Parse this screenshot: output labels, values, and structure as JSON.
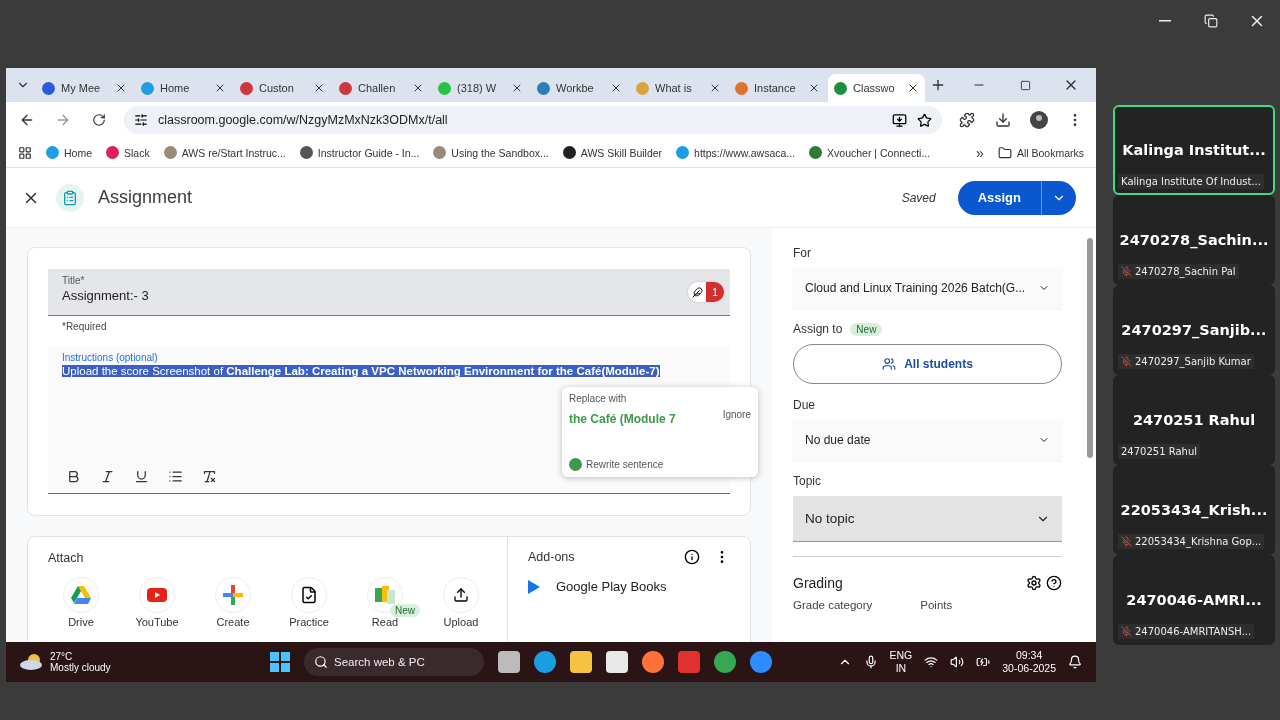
{
  "browser": {
    "tabs": [
      {
        "label": "My Mee",
        "selected": false,
        "color": "#2d5bd8"
      },
      {
        "label": "Home",
        "selected": false,
        "color": "#1f9ce4"
      },
      {
        "label": "Custon",
        "selected": false,
        "color": "#d0343e"
      },
      {
        "label": "Challen",
        "selected": false,
        "color": "#d0343e"
      },
      {
        "label": "(318) W",
        "selected": false,
        "color": "#25c449"
      },
      {
        "label": "Workbe",
        "selected": false,
        "color": "#2a7fb8"
      },
      {
        "label": "What is",
        "selected": false,
        "color": "#d9a53a"
      },
      {
        "label": "Instance",
        "selected": false,
        "color": "#e0722b"
      },
      {
        "label": "Classwo",
        "selected": true,
        "color": "#1e8e3e"
      }
    ],
    "url": "classroom.google.com/w/NzgyMzMxNzk3ODMx/t/all",
    "bookmarks": [
      {
        "label": "Home",
        "color": "#1f9ce4"
      },
      {
        "label": "Slack",
        "color": "#e01e5a"
      },
      {
        "label": "AWS re/Start Instruc...",
        "color": "#9a8a7a"
      },
      {
        "label": "Instructor Guide - In...",
        "color": "#555555"
      },
      {
        "label": "Using the Sandbox...",
        "color": "#9a8a7a"
      },
      {
        "label": "AWS Skill Builder",
        "color": "#222222"
      },
      {
        "label": "https://www.awsaca...",
        "color": "#1f9ce4"
      },
      {
        "label": "Xvoucher | Connecti...",
        "color": "#2e7d32"
      }
    ],
    "bookmarks_more": "»",
    "all_bookmarks": "All Bookmarks"
  },
  "classroom": {
    "header": {
      "title": "Assignment",
      "status": "Saved",
      "assign": "Assign"
    },
    "title_field": {
      "label": "Title*",
      "value": "Assignment:- 3",
      "issues": "1"
    },
    "required_note": "*Required",
    "instructions": {
      "label": "Instructions (optional)",
      "value": "Upload the score Screenshot of  **Challenge Lab: Creating a VPC Networking Environment for the Café(Module-7)**",
      "selected": true
    },
    "suggestion": {
      "heading": "Replace with",
      "replacement": "the Café (Module 7",
      "ignore": "Ignore",
      "rewrite": "Rewrite sentence"
    },
    "attach": {
      "heading": "Attach",
      "items": [
        {
          "kind": "drive",
          "label": "Drive"
        },
        {
          "kind": "youtube",
          "label": "YouTube"
        },
        {
          "kind": "create",
          "label": "Create"
        },
        {
          "kind": "practice",
          "label": "Practice"
        },
        {
          "kind": "read",
          "label": "Read",
          "badge": "New"
        },
        {
          "kind": "upload",
          "label": "Upload"
        }
      ]
    },
    "addons": {
      "heading": "Add-ons",
      "items": [
        "Google Play Books"
      ]
    },
    "sidebar": {
      "for": {
        "label": "For",
        "value": "Cloud and Linux Training 2026 Batch(G..."
      },
      "assign_to": {
        "label": "Assign to",
        "badge": "New",
        "button": "All students"
      },
      "due": {
        "label": "Due",
        "value": "No due date"
      },
      "topic": {
        "label": "Topic",
        "value": "No topic"
      },
      "grading": {
        "heading": "Grading",
        "columns": [
          "Grade category",
          "Points"
        ]
      }
    }
  },
  "taskbar": {
    "weather": {
      "temperature": "27°C",
      "condition": "Mostly cloudy"
    },
    "search": {
      "placeholder": "Search web & PC"
    },
    "language": [
      "ENG",
      "IN"
    ],
    "time": "09:34",
    "date": "30-06-2025"
  },
  "participants": [
    {
      "name": "Kalinga  Institut...",
      "subtitle": "Kalinga Institute Of Indust...",
      "muted": false,
      "speaking": true
    },
    {
      "name": "2470278_Sachin...",
      "subtitle": "2470278_Sachin Pal",
      "muted": true,
      "speaking": false
    },
    {
      "name": "2470297_Sanjib...",
      "subtitle": "2470297_Sanjib Kumar",
      "muted": true,
      "speaking": false
    },
    {
      "name": "2470251 Rahul",
      "subtitle": "2470251 Rahul",
      "muted": false,
      "speaking": false
    },
    {
      "name": "22053434_Krish...",
      "subtitle": "22053434_Krishna Gop...",
      "muted": true,
      "speaking": false
    },
    {
      "name": "2470046-AMRI...",
      "subtitle": "2470046-AMRITANSH...",
      "muted": true,
      "speaking": false
    }
  ]
}
